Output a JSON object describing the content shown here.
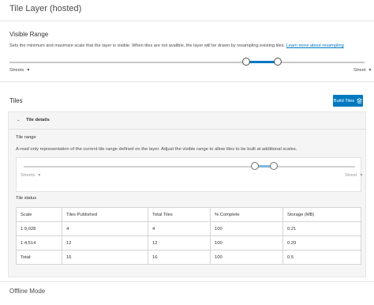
{
  "header": {
    "title": "Tile Layer (hosted)"
  },
  "visible_range": {
    "heading": "Visible Range",
    "description": "Sets the minimum and maximize scale that the layer is visible. When tiles are not availble, the layer will be drawn by resampling existing tiles.",
    "learn_more": "Learn more about resampling",
    "min_scale": "Streets",
    "max_scale": "Street"
  },
  "tiles": {
    "heading": "Tiles",
    "build_button": "Build Tiles",
    "details": {
      "heading": "Tile details",
      "range_label": "Tile range",
      "range_description": "A read only representation of the current tile range defined on the layer. Adjust the visible range to allow tiles to be built at additional scales.",
      "min_scale": "Streets",
      "max_scale": "Street",
      "status_label": "Tile status",
      "table": {
        "headers": [
          "Scale",
          "Tiles Published",
          "Total Tiles",
          "% Complete",
          "Storage (MB)"
        ],
        "rows": [
          [
            "1:9,028",
            "4",
            "4",
            "100",
            "0.21"
          ],
          [
            "1:4,514",
            "12",
            "12",
            "100",
            "0.29"
          ],
          [
            "Total:",
            "16",
            "16",
            "100",
            "0.5"
          ]
        ]
      }
    }
  },
  "offline": {
    "heading": "Offline Mode"
  },
  "colors": {
    "accent": "#0079c1",
    "panel_bg": "#f5f5f5",
    "text": "#323232"
  },
  "icons": {
    "build": "layers-icon",
    "collapse": "chevron-down-icon",
    "dropdown": "caret-down-icon"
  }
}
